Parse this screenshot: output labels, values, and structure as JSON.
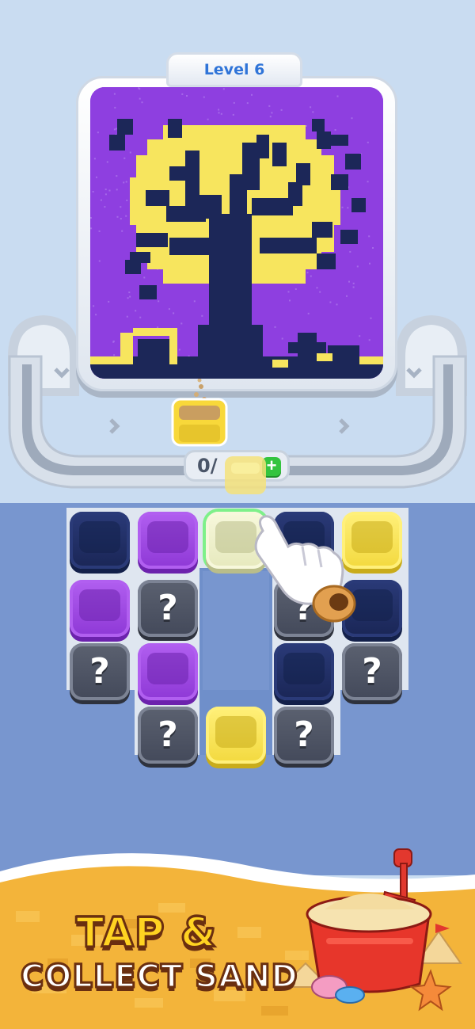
{
  "level": {
    "label": "Level 6"
  },
  "counter": {
    "text": "0/",
    "plus_label": "+"
  },
  "promo": {
    "line1": "TAP &",
    "line2": "COLLECT SAND"
  },
  "colors": {
    "navy": "#1e2b5e",
    "purple": "#9a45e0",
    "yellow": "#f7e35a",
    "pale_yellow": "#eef0c4",
    "mystery_gray": "#4f5564",
    "board_blue": "#7896cf",
    "canvas_purple": "#8e3fe0",
    "sand": "#f4b73a"
  },
  "board": {
    "rows": [
      [
        {
          "kind": "bucket",
          "color": "navy"
        },
        {
          "kind": "bucket",
          "color": "purple"
        },
        {
          "kind": "bucket",
          "color": "pale_yellow",
          "highlighted": true
        },
        {
          "kind": "bucket",
          "color": "navy"
        },
        {
          "kind": "bucket",
          "color": "yellow"
        }
      ],
      [
        {
          "kind": "bucket",
          "color": "purple"
        },
        {
          "kind": "mystery",
          "label": "?"
        },
        {
          "kind": "empty"
        },
        {
          "kind": "mystery",
          "label": "?"
        },
        {
          "kind": "bucket",
          "color": "navy"
        }
      ],
      [
        {
          "kind": "mystery",
          "label": "?"
        },
        {
          "kind": "bucket",
          "color": "purple"
        },
        {
          "kind": "empty"
        },
        {
          "kind": "bucket",
          "color": "navy"
        },
        {
          "kind": "mystery",
          "label": "?"
        }
      ],
      [
        {
          "kind": "none"
        },
        {
          "kind": "mystery",
          "label": "?"
        },
        {
          "kind": "bucket",
          "color": "yellow"
        },
        {
          "kind": "mystery",
          "label": "?"
        },
        {
          "kind": "none"
        }
      ]
    ]
  }
}
